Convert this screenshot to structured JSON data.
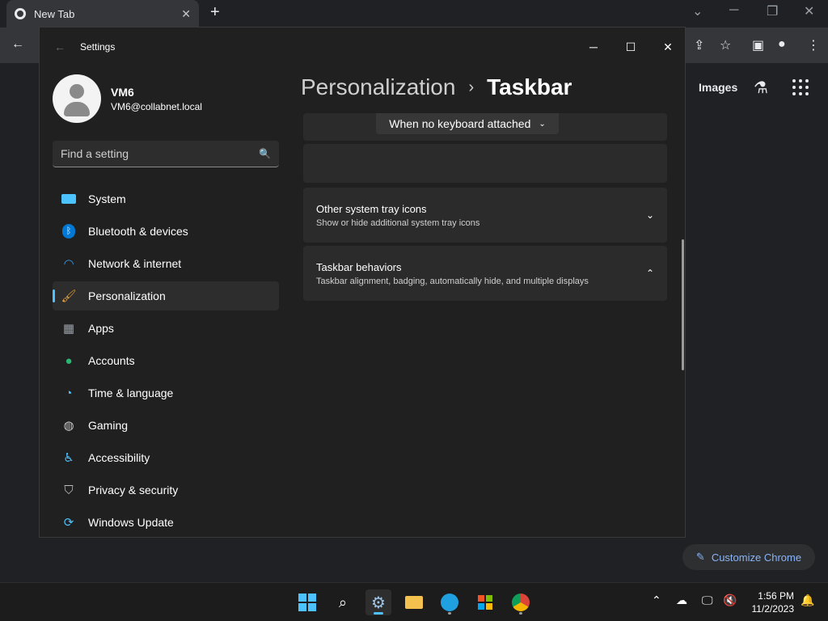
{
  "chrome": {
    "tab_title": "New Tab",
    "tab_close": "✕",
    "new_tab": "+",
    "images_link": "Images",
    "customize_label": "Customize Chrome"
  },
  "settings": {
    "window_title": "Settings",
    "profile": {
      "name": "VM6",
      "email": "VM6@collabnet.local"
    },
    "search": {
      "placeholder": "Find a setting"
    },
    "nav": [
      {
        "label": "System",
        "icon": "system-icon",
        "color": "#4cc2ff"
      },
      {
        "label": "Bluetooth & devices",
        "icon": "bluetooth-icon",
        "color": "#0078d4"
      },
      {
        "label": "Network & internet",
        "icon": "wifi-icon",
        "color": "#3a96dd"
      },
      {
        "label": "Personalization",
        "icon": "brush-icon",
        "color": "#e8a33d"
      },
      {
        "label": "Apps",
        "icon": "apps-icon",
        "color": "#9aa0a6"
      },
      {
        "label": "Accounts",
        "icon": "person-icon",
        "color": "#2bb673"
      },
      {
        "label": "Time & language",
        "icon": "globe-clock-icon",
        "color": "#4cc2ff"
      },
      {
        "label": "Gaming",
        "icon": "gamepad-icon",
        "color": "#c8c8c8"
      },
      {
        "label": "Accessibility",
        "icon": "accessibility-icon",
        "color": "#4cc2ff"
      },
      {
        "label": "Privacy & security",
        "icon": "shield-icon",
        "color": "#bdbdbd"
      },
      {
        "label": "Windows Update",
        "icon": "update-icon",
        "color": "#4cc2ff"
      }
    ],
    "breadcrumb": {
      "parent": "Personalization",
      "separator": "›",
      "current": "Taskbar"
    },
    "dropdown_value": "When no keyboard attached",
    "cards": [
      {
        "title": "Other system tray icons",
        "subtitle": "Show or hide additional system tray icons",
        "chevron": "⌄"
      },
      {
        "title": "Taskbar behaviors",
        "subtitle": "Taskbar alignment, badging, automatically hide, and multiple displays",
        "chevron": "⌃"
      }
    ]
  },
  "taskbar": {
    "time": "1:56 PM",
    "date": "11/2/2023"
  }
}
